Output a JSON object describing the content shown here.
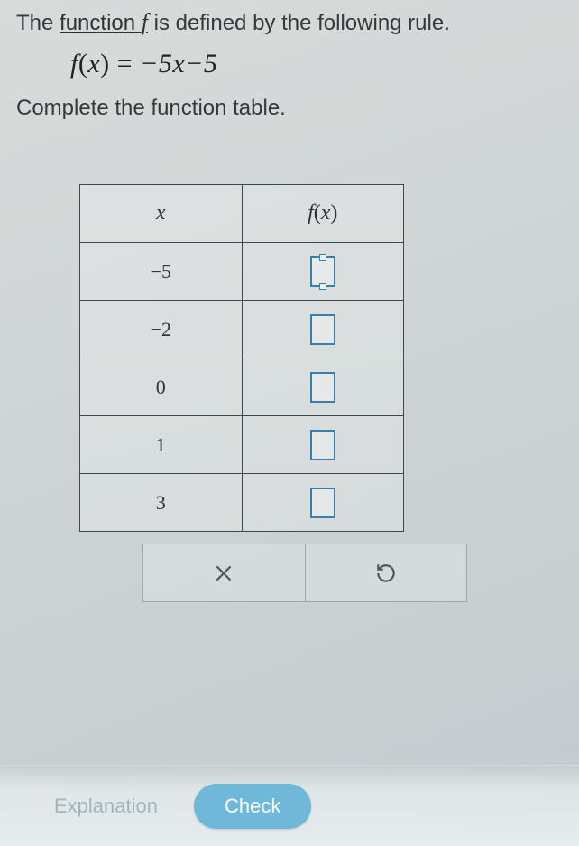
{
  "intro": {
    "prefix": "The ",
    "link": "function ",
    "fvar": "f",
    "suffix": " is defined by the following rule."
  },
  "formula": {
    "lhs_f": "f",
    "lhs_open": "(",
    "lhs_x": "x",
    "lhs_close": ")",
    "eq": " = ",
    "rhs": "−5x−5"
  },
  "instruction": "Complete the function table.",
  "table": {
    "headers": {
      "x": "x",
      "fx_f": "f",
      "fx_open": "(",
      "fx_x": "x",
      "fx_close": ")"
    },
    "rows": [
      {
        "x": "−5",
        "active": true
      },
      {
        "x": "−2",
        "active": false
      },
      {
        "x": "0",
        "active": false
      },
      {
        "x": "1",
        "active": false
      },
      {
        "x": "3",
        "active": false
      }
    ]
  },
  "toolbar": {
    "clear_icon": "clear-x-icon",
    "reset_icon": "reset-icon"
  },
  "footer": {
    "explanation": "Explanation",
    "check": "Check"
  }
}
